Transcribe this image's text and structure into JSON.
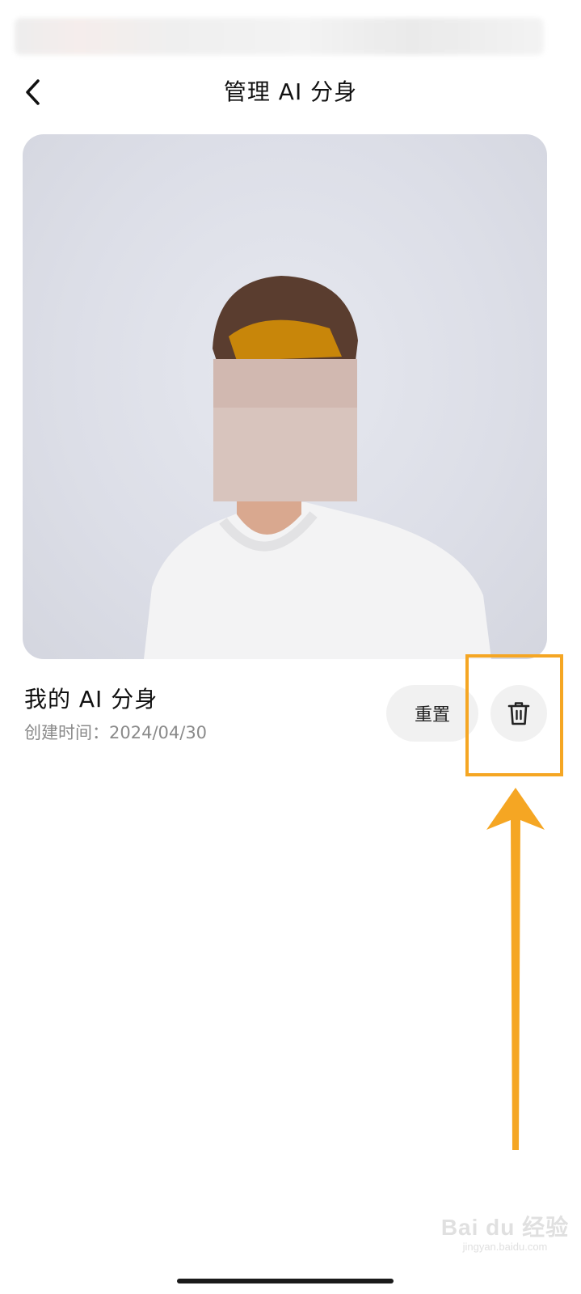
{
  "header": {
    "title": "管理 AI 分身",
    "back_icon": "chevron-left-icon"
  },
  "avatar": {
    "name": "我的 AI 分身",
    "created": "创建时间：2024/04/30"
  },
  "actions": {
    "reset_label": "重置",
    "delete_icon": "trash-icon"
  },
  "annotation": {
    "color": "#f5a623"
  },
  "watermark": {
    "logo": "Bai du 经验",
    "url": "jingyan.baidu.com"
  }
}
